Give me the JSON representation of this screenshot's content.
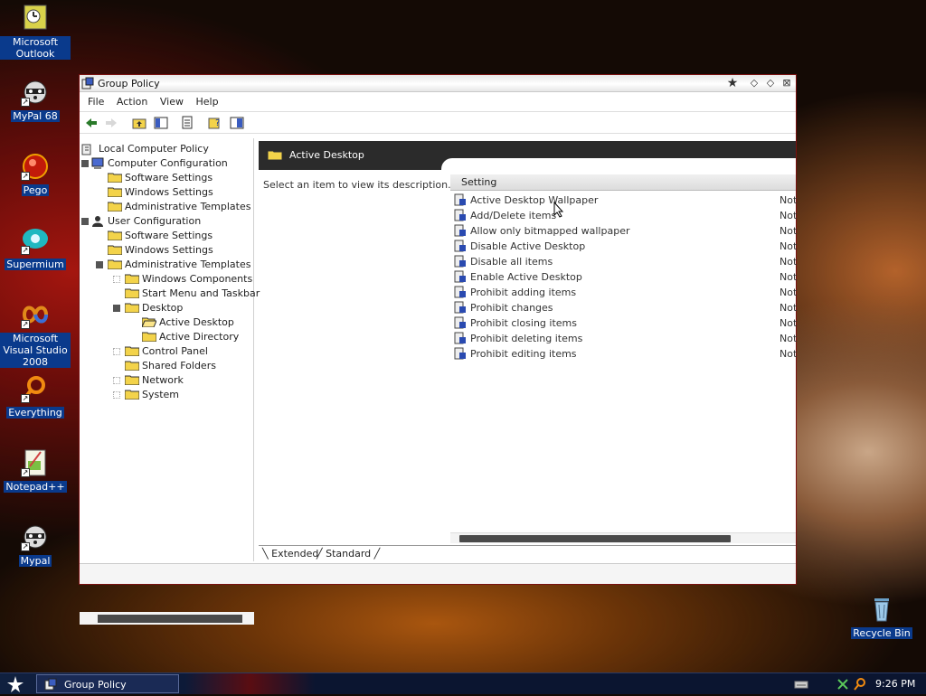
{
  "desktop": {
    "icons": [
      {
        "label": "Microsoft Outlook"
      },
      {
        "label": "MyPal 68"
      },
      {
        "label": "Pego"
      },
      {
        "label": "Supermium"
      },
      {
        "label": "Microsoft Visual Studio 2008"
      },
      {
        "label": "Everything"
      },
      {
        "label": "Notepad++"
      },
      {
        "label": "Mypal"
      },
      {
        "label": "Recycle Bin"
      }
    ]
  },
  "window": {
    "title": "Group Policy",
    "menu": [
      "File",
      "Action",
      "View",
      "Help"
    ],
    "tree": [
      {
        "label": "Local Computer Policy"
      },
      {
        "label": "Computer Configuration"
      },
      {
        "label": "Software Settings"
      },
      {
        "label": "Windows Settings"
      },
      {
        "label": "Administrative Templates"
      },
      {
        "label": "User Configuration"
      },
      {
        "label": "Software Settings"
      },
      {
        "label": "Windows Settings"
      },
      {
        "label": "Administrative Templates"
      },
      {
        "label": "Windows Components"
      },
      {
        "label": "Start Menu and Taskbar"
      },
      {
        "label": "Desktop"
      },
      {
        "label": "Active Desktop"
      },
      {
        "label": "Active Directory"
      },
      {
        "label": "Control Panel"
      },
      {
        "label": "Shared Folders"
      },
      {
        "label": "Network"
      },
      {
        "label": "System"
      }
    ],
    "selected_node": "Active Desktop",
    "pane": {
      "header": "Active Desktop",
      "description": "Select an item to view its description.",
      "column_setting": "Setting",
      "rows": [
        {
          "name": "Active Desktop Wallpaper",
          "state": "Not"
        },
        {
          "name": "Add/Delete items",
          "state": "Not"
        },
        {
          "name": "Allow only bitmapped wallpaper",
          "state": "Not"
        },
        {
          "name": "Disable Active Desktop",
          "state": "Not"
        },
        {
          "name": "Disable all items",
          "state": "Not"
        },
        {
          "name": "Enable Active Desktop",
          "state": "Not"
        },
        {
          "name": "Prohibit adding items",
          "state": "Not"
        },
        {
          "name": "Prohibit changes",
          "state": "Not"
        },
        {
          "name": "Prohibit closing items",
          "state": "Not"
        },
        {
          "name": "Prohibit deleting items",
          "state": "Not"
        },
        {
          "name": "Prohibit editing items",
          "state": "Not"
        }
      ],
      "tabs": [
        "Extended",
        "Standard"
      ]
    }
  },
  "taskbar": {
    "task_label": "Group Policy",
    "clock": "9:26 PM"
  },
  "colors": {
    "desktop_label_bg": "#0a3a8c",
    "window_border": "#7a1010",
    "pane_header_bg": "#2b2b2b",
    "folder": "#f3d34a"
  }
}
